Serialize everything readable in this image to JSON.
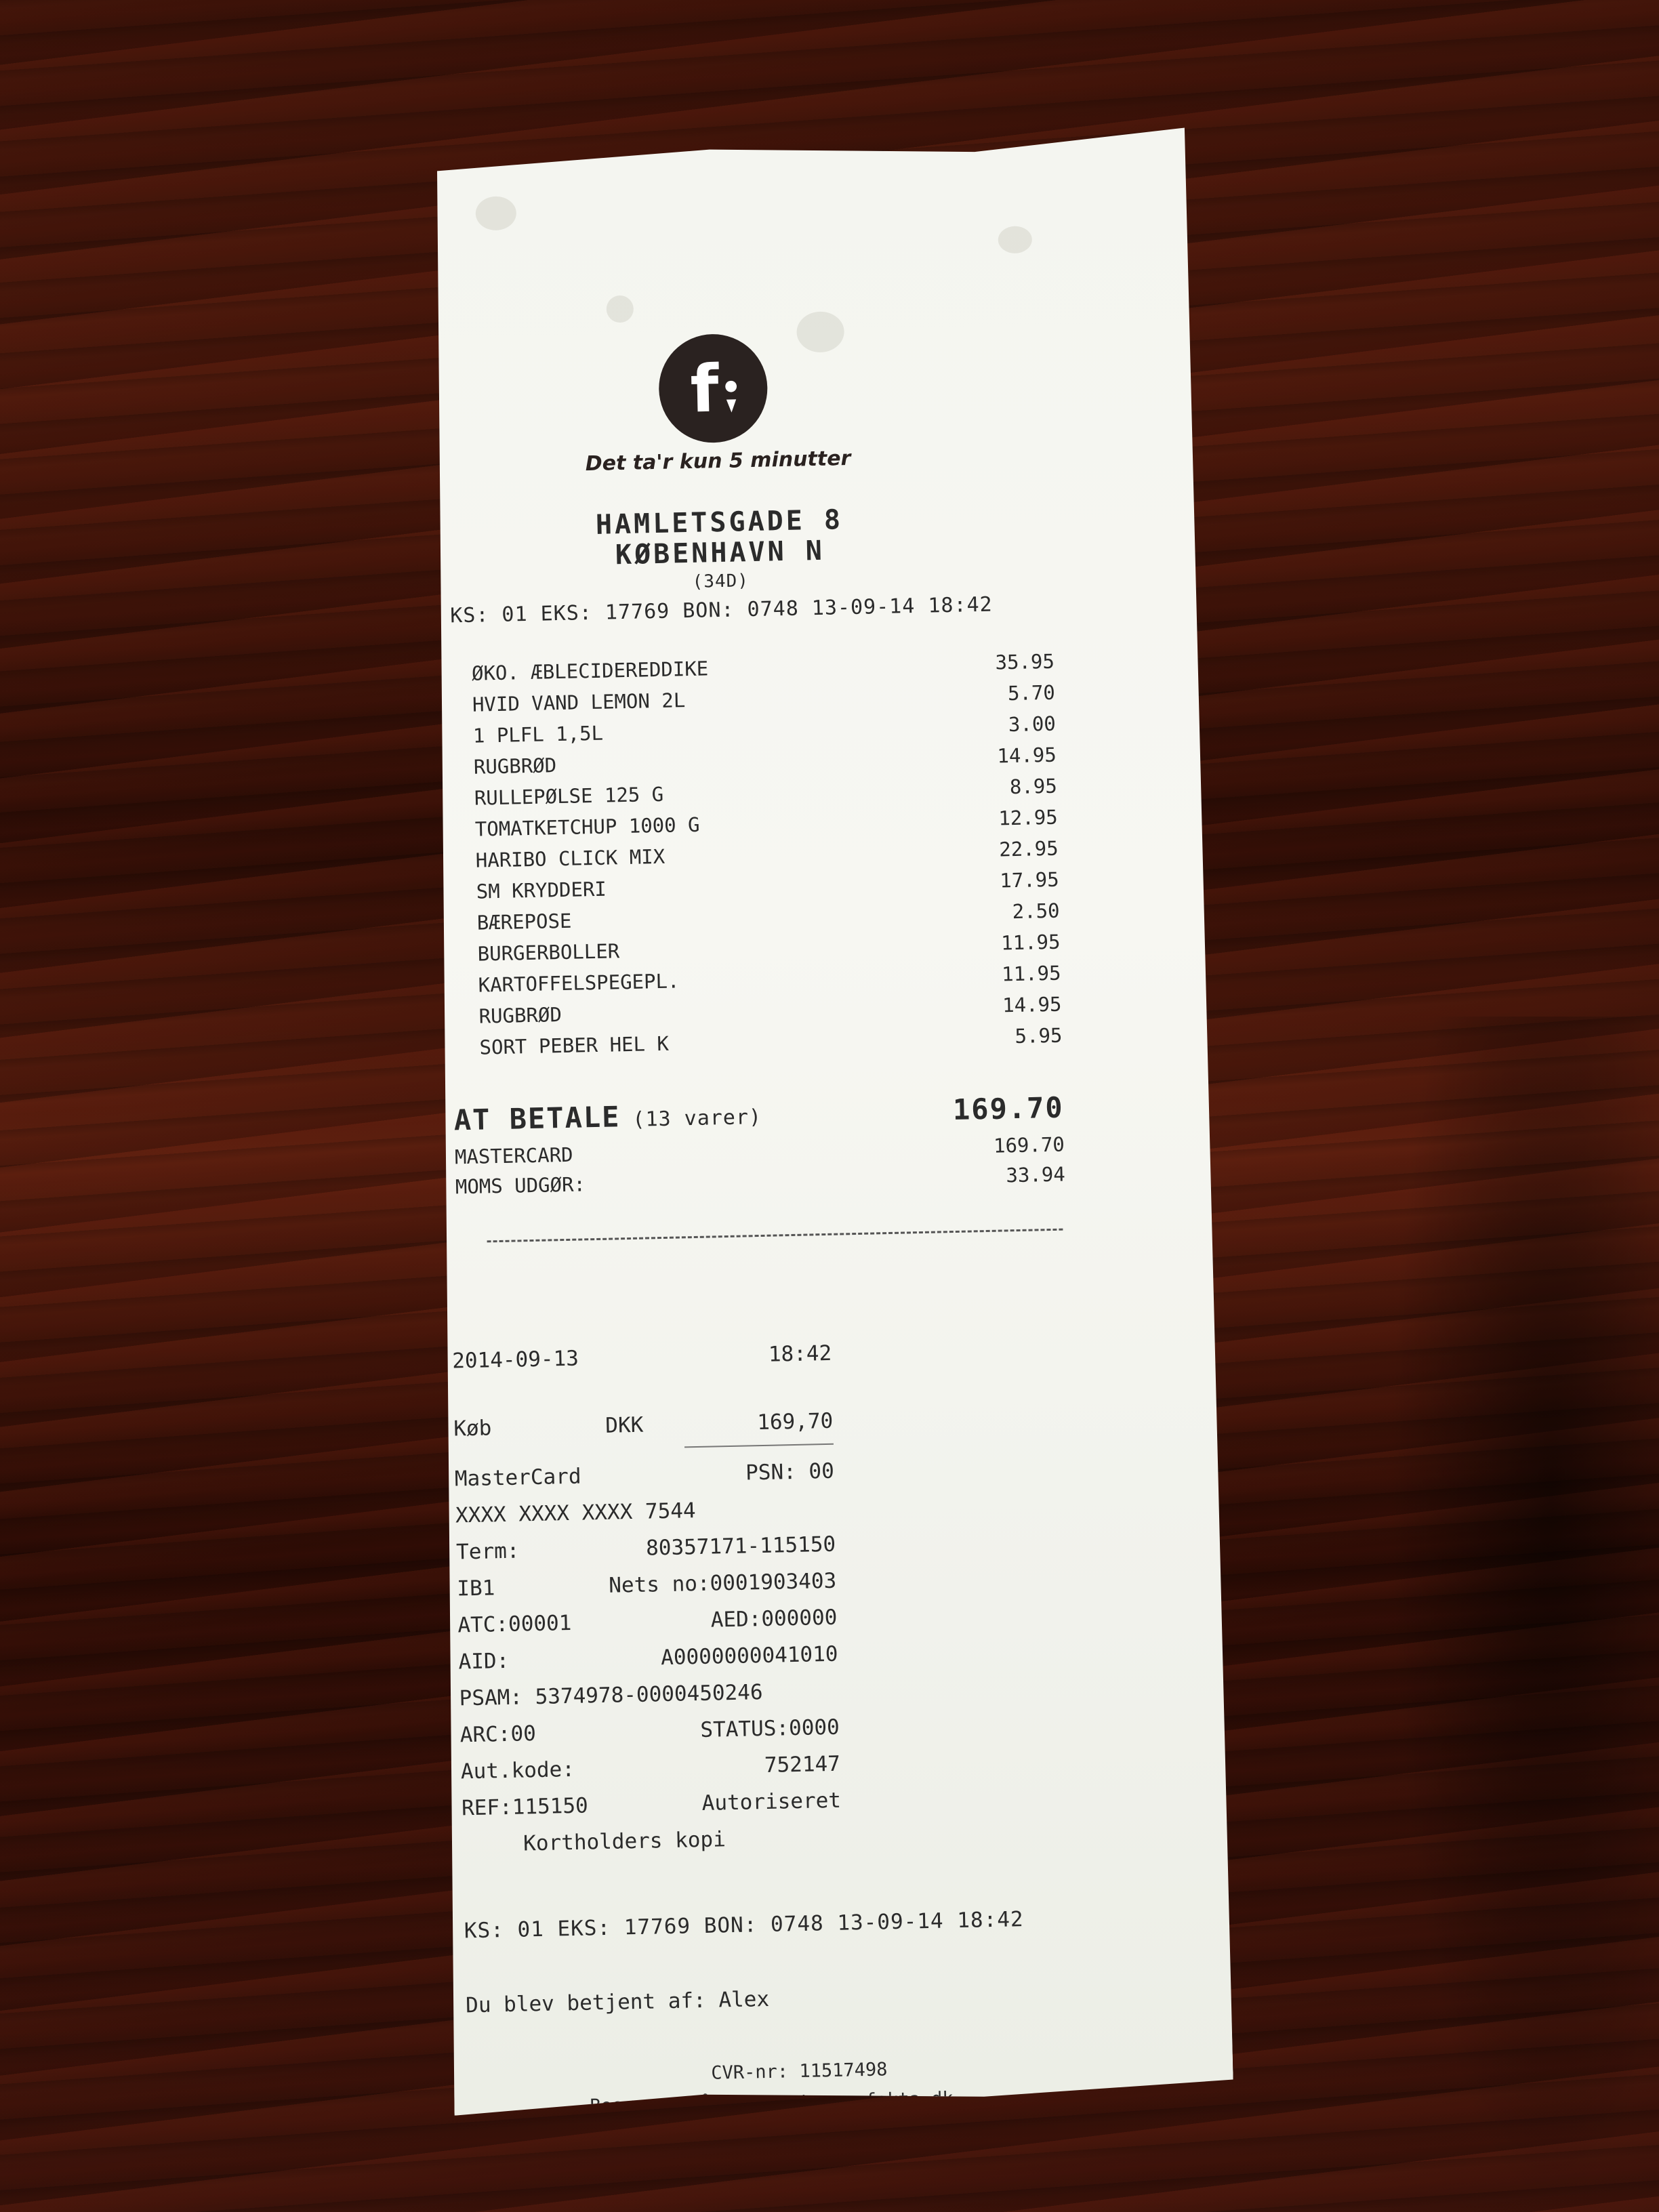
{
  "receipt": {
    "logo_text": "f;",
    "slogan": "Det ta'r kun 5 minutter",
    "address_line1": "HAMLETSGADE 8",
    "address_line2": "KØBENHAVN N",
    "store_code": "(34D)",
    "header": "KS: 01 EKS: 17769 BON: 0748 13-09-14 18:42",
    "items": [
      {
        "name": "ØKO. ÆBLECIDEREDDIKE",
        "price": "35.95"
      },
      {
        "name": "HVID VAND LEMON 2L",
        "price": "5.70"
      },
      {
        "name": "1 PLFL 1,5L",
        "price": "3.00"
      },
      {
        "name": "RUGBRØD",
        "price": "14.95"
      },
      {
        "name": "RULLEPØLSE 125 G",
        "price": "8.95"
      },
      {
        "name": "TOMATKETCHUP 1000 G",
        "price": "12.95"
      },
      {
        "name": "HARIBO CLICK MIX",
        "price": "22.95"
      },
      {
        "name": "SM KRYDDERI",
        "price": "17.95"
      },
      {
        "name": "BÆREPOSE",
        "price": "2.50"
      },
      {
        "name": "BURGERBOLLER",
        "price": "11.95"
      },
      {
        "name": "KARTOFFELSPEGEPL.",
        "price": "11.95"
      },
      {
        "name": "RUGBRØD",
        "price": "14.95"
      },
      {
        "name": "SORT PEBER HEL K",
        "price": "5.95"
      }
    ],
    "total_label": "AT BETALE",
    "total_qty": "(13 varer)",
    "total_amount": "169.70",
    "payment_method": "MASTERCARD",
    "payment_amount": "169.70",
    "vat_label": "MOMS UDGØR:",
    "vat_amount": "33.94",
    "card_slip": {
      "date": "2014-09-13",
      "time": "18:42",
      "purchase_label": "Køb",
      "currency": "DKK",
      "amount": "169,70",
      "card_type": "MasterCard",
      "psn": "PSN: 00",
      "card_number": "XXXX XXXX XXXX 7544",
      "term_label": "Term:",
      "term_value": "80357171-115150",
      "ib1": "IB1",
      "nets_no": "Nets no:0001903403",
      "atc": "ATC:00001",
      "aed": "AED:000000",
      "aid_label": "AID:",
      "aid_value": "A0000000041010",
      "psam": "PSAM: 5374978-0000450246",
      "arc": "ARC:00",
      "status": "STATUS:0000",
      "aut_label": "Aut.kode:",
      "aut_value": "752147",
      "ref": "REF:115150",
      "authorized": "Autoriseret",
      "copy_note": "Kortholders kopi"
    },
    "footer_header": "KS: 01 EKS: 17769 BON: 0748 13-09-14 18:42",
    "served_by": "Du blev betjent af: Alex",
    "cvr": "CVR-nr: 11517498",
    "website": "Besøg os på internet www.fakta.dk"
  }
}
